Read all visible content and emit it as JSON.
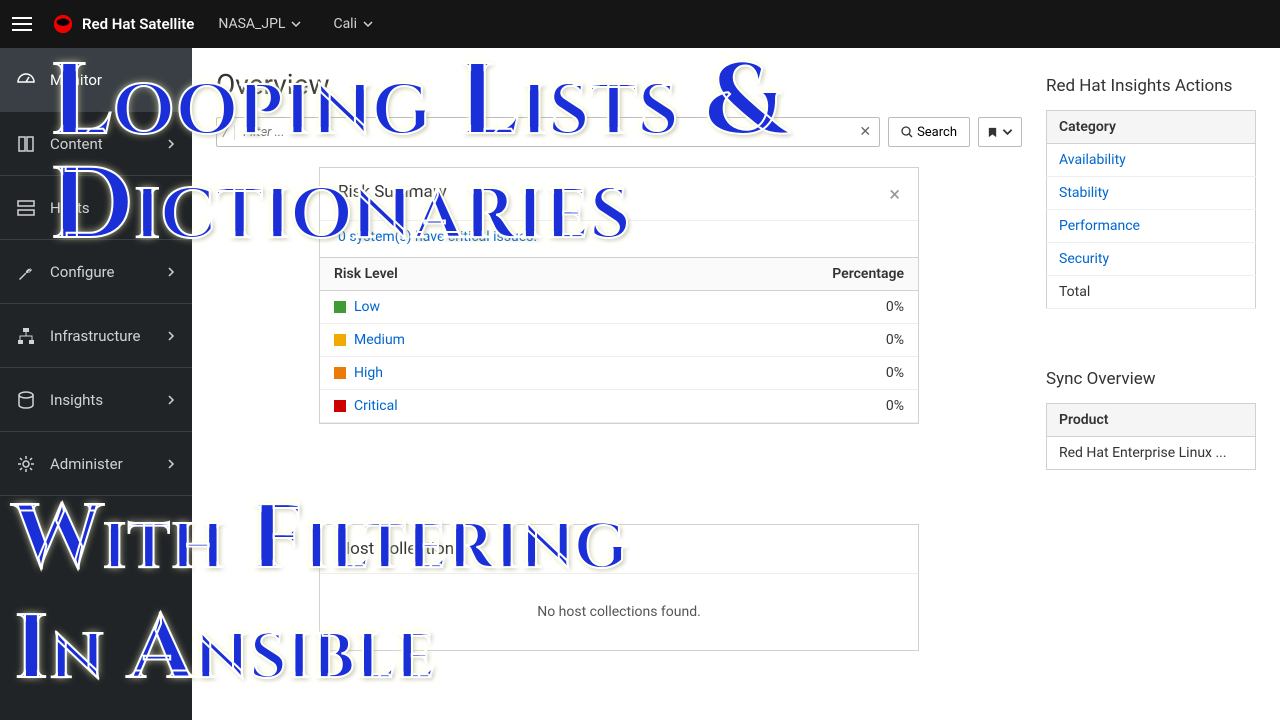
{
  "topbar": {
    "brand": "Red Hat Satellite",
    "org": "NASA_JPL",
    "loc": "Cali"
  },
  "sidebar": {
    "items": [
      {
        "label": "Monitor",
        "active": true,
        "chev": false
      },
      {
        "label": "Content",
        "active": false,
        "chev": true
      },
      {
        "label": "Hosts",
        "active": false,
        "chev": false
      },
      {
        "label": "Configure",
        "active": false,
        "chev": true
      },
      {
        "label": "Infrastructure",
        "active": false,
        "chev": true
      },
      {
        "label": "Insights",
        "active": false,
        "chev": true
      },
      {
        "label": "Administer",
        "active": false,
        "chev": true
      }
    ]
  },
  "page": {
    "title": "Overview"
  },
  "search": {
    "placeholder": "Filter ...",
    "btn": "Search"
  },
  "riskCard": {
    "title": "Risk Summary",
    "subtitle": "0 system(s) have critical issues.",
    "cols": [
      "Risk Level",
      "Percentage"
    ],
    "rows": [
      {
        "label": "Low",
        "color": "#3f9c35",
        "pct": "0%"
      },
      {
        "label": "Medium",
        "color": "#f0ab00",
        "pct": "0%"
      },
      {
        "label": "High",
        "color": "#ec7a08",
        "pct": "0%"
      },
      {
        "label": "Critical",
        "color": "#cc0000",
        "pct": "0%"
      }
    ]
  },
  "hostCard": {
    "title": "Host Collections",
    "empty": "No host collections found."
  },
  "insights": {
    "title": "Red Hat Insights Actions",
    "colhdr": "Category",
    "cats": [
      "Availability",
      "Stability",
      "Performance",
      "Security"
    ],
    "total": "Total"
  },
  "sync": {
    "title": "Sync Overview",
    "colhdr": "Product",
    "rows": [
      "Red Hat Enterprise Linux ..."
    ]
  },
  "overlay": {
    "l1": "Looping Lists &",
    "l2": "Dictionaries",
    "l3": "With Filtering",
    "l4": "In Ansible"
  }
}
